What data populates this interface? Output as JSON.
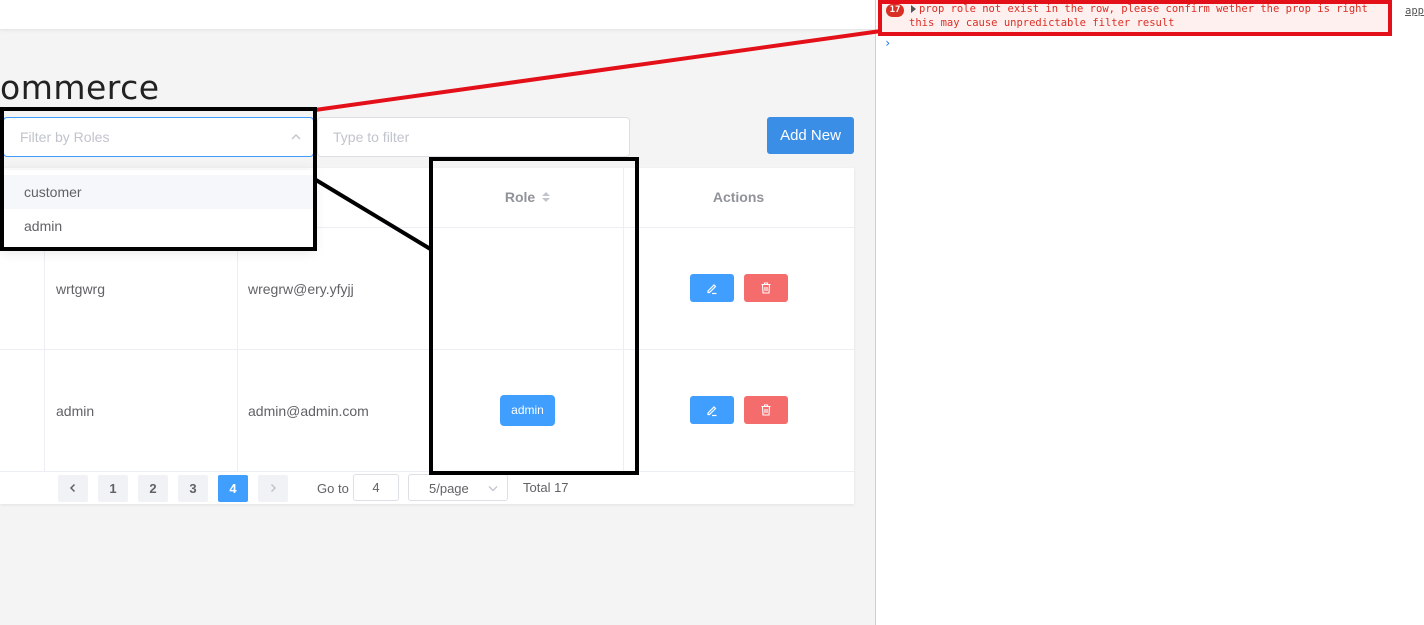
{
  "app": {
    "page_title": "ommerce",
    "role_filter": {
      "placeholder": "Filter by Roles"
    },
    "text_filter": {
      "placeholder": "Type to filter"
    },
    "add_button": "Add New",
    "dropdown": {
      "options": [
        "customer",
        "admin"
      ]
    },
    "table": {
      "headers": {
        "role": "Role",
        "actions": "Actions"
      },
      "rows": [
        {
          "name": "wrtgwrg",
          "email": "wregrw@ery.yfyjj",
          "role": ""
        },
        {
          "name": "admin",
          "email": "admin@admin.com",
          "role": "admin"
        }
      ]
    },
    "pagination": {
      "pages": [
        "1",
        "2",
        "3",
        "4"
      ],
      "current_page": "4",
      "goto_label": "Go to",
      "goto_value": "4",
      "page_size": "5/page",
      "total": "Total 17"
    },
    "colors": {
      "primary": "#409eff",
      "danger": "#f56c6c",
      "annotation_red": "#e3101a"
    }
  },
  "console": {
    "error_count": "17",
    "message_line1": "prop role not exist in the row, please confirm wether the prop is right",
    "message_line2": "this may cause unpredictable filter result",
    "source_link": "app",
    "prompt_symbol": "›"
  }
}
